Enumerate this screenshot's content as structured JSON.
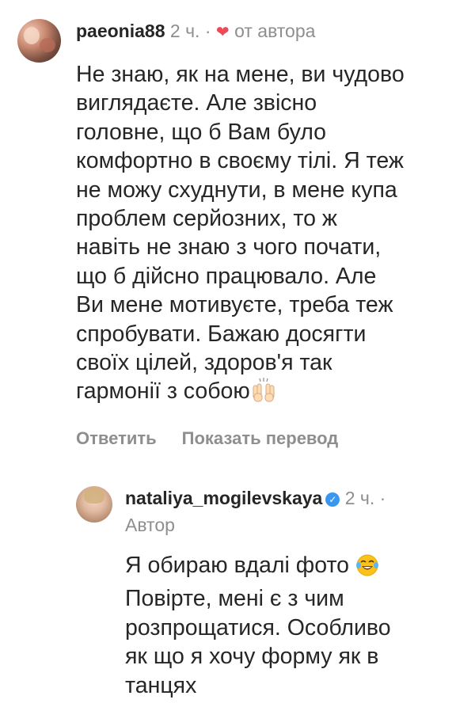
{
  "main_comment": {
    "username": "paeonia88",
    "time": "2 ч.",
    "separator": "·",
    "heart_icon": "heart-icon",
    "from_author": "от автора",
    "lines": [
      "Не знаю, як на мене, ви чудово",
      "виглядаєте. Але звісно",
      "головне, що б Вам було",
      "комфортно в своєму тілі. Я теж",
      "не можу схуднути, в мене купа",
      "проблем серйозних, то ж",
      "навіть не знаю з чого почати,",
      "що б дійсно працювало. Але",
      "Ви мене мотивуєте, треба теж",
      "спробувати. Бажаю досягти",
      "своїх цілей, здоров'я так",
      "гармонії з собою"
    ]
  },
  "actions": {
    "reply": "Ответить",
    "translate": "Показать перевод"
  },
  "reply_comment": {
    "username": "nataliya_mogilevskaya",
    "verified_icon": "verified-badge-icon",
    "time": "2 ч.",
    "separator": "·",
    "author_label": "Автор",
    "lines": [
      "Я обираю вдалі фото",
      "Повірте, мені є з чим",
      "розпрощатися. Особливо",
      "як що я хочу форму як в",
      "танцях"
    ]
  }
}
